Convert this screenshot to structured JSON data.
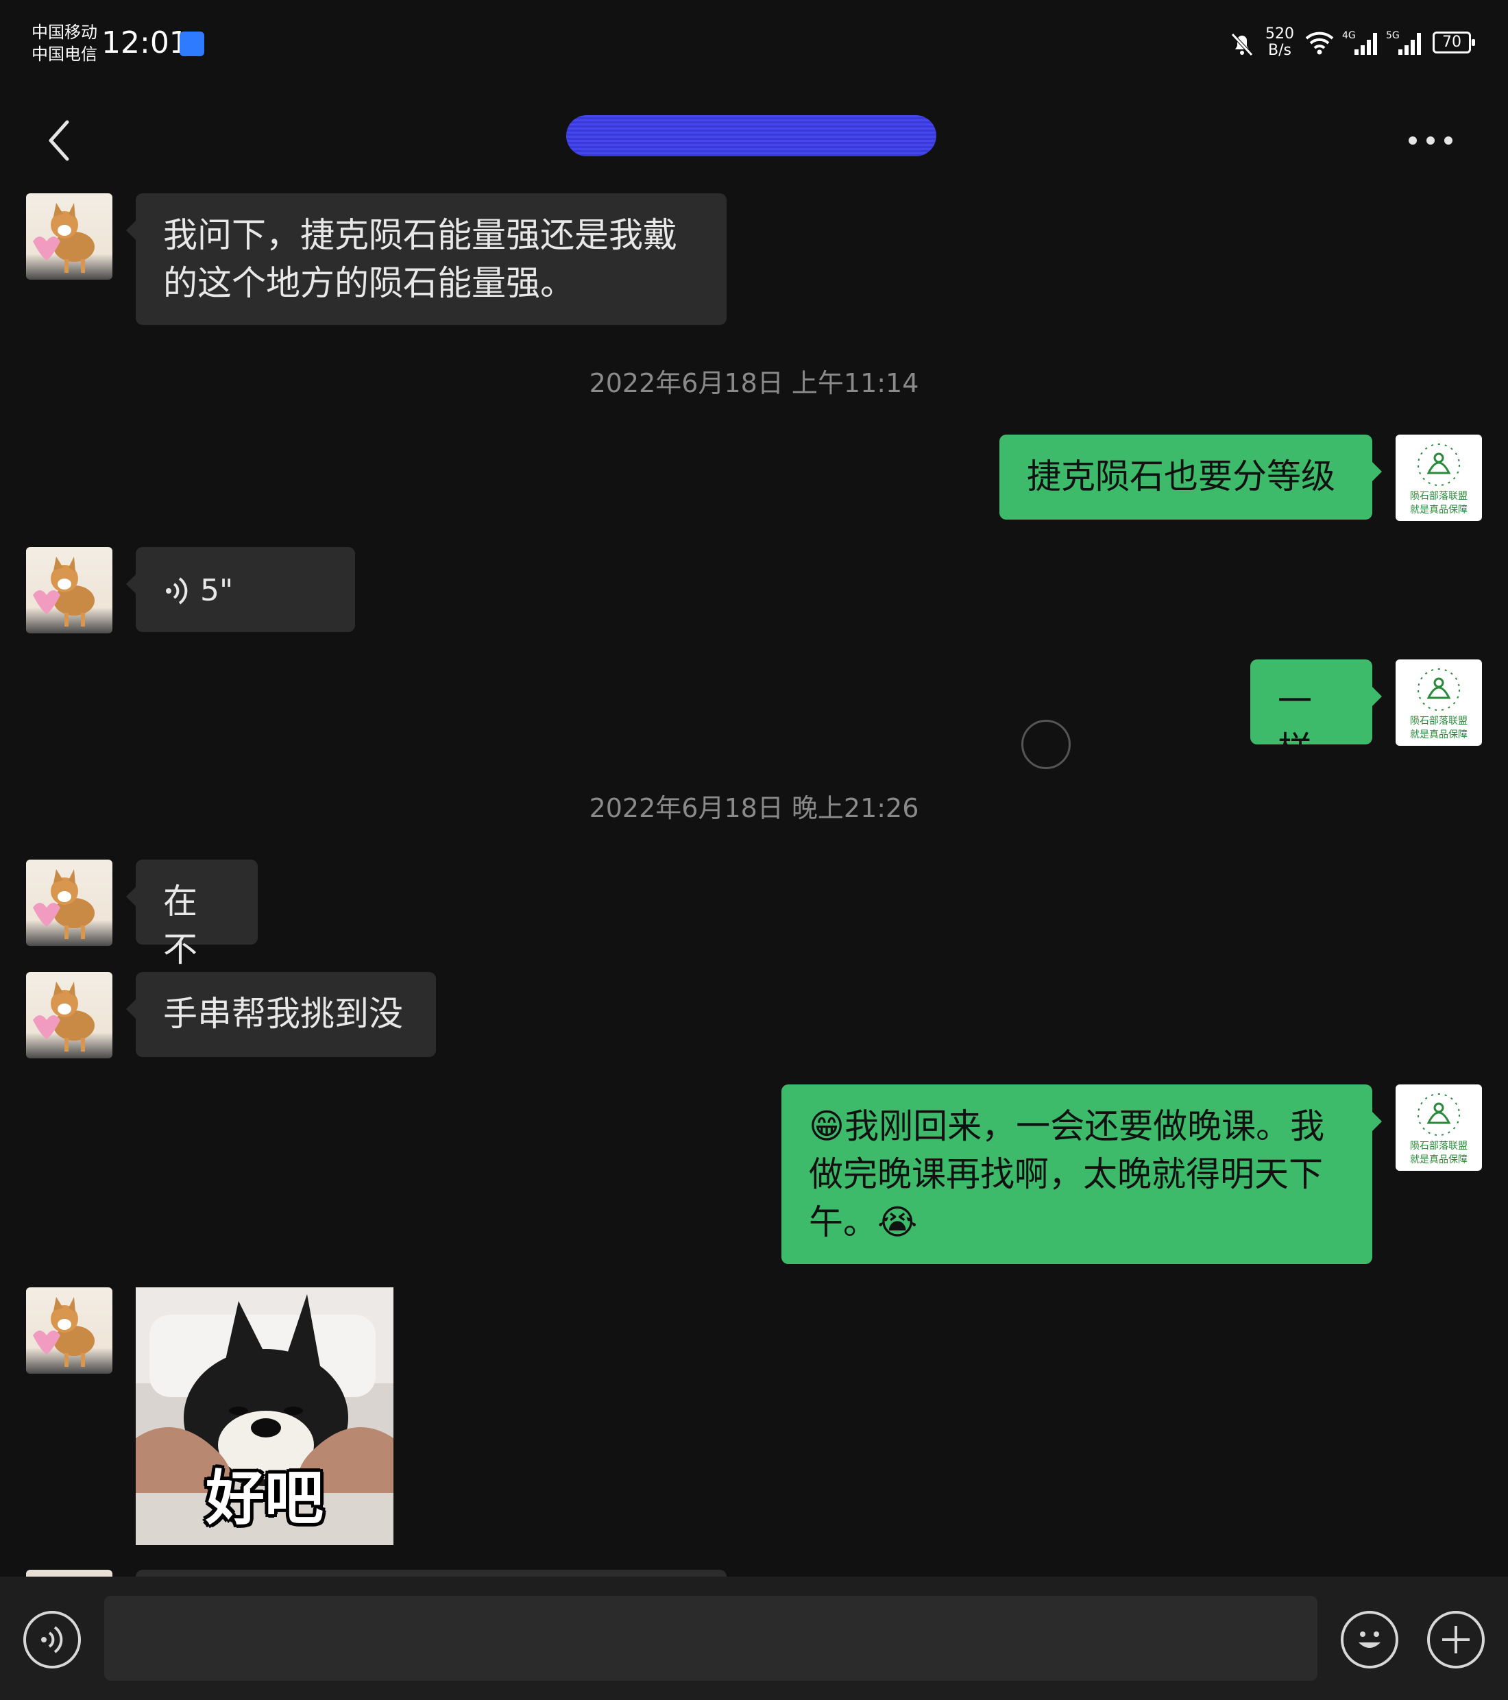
{
  "status_bar": {
    "carrier1": "中国移动",
    "carrier2": "中国电信",
    "time": "12:01",
    "net_speed_value": "520",
    "net_speed_unit": "B/s",
    "battery": "70",
    "icons": [
      "bell-off-icon",
      "wifi-icon",
      "signal-4g-icon",
      "signal-5g-icon",
      "battery-icon"
    ]
  },
  "nav": {
    "back_icon": "chevron-left-icon",
    "more_icon": "more-dots-icon"
  },
  "messages": [
    {
      "side": "in",
      "type": "text",
      "text": "我问下，捷克陨石能量强还是我戴的这个地方的陨石能量强。"
    },
    {
      "type": "time",
      "text": "2022年6月18日 上午11:14"
    },
    {
      "side": "out",
      "type": "text",
      "text": "捷克陨石也要分等级"
    },
    {
      "side": "in",
      "type": "voice",
      "text": "5\""
    },
    {
      "side": "out",
      "type": "text",
      "text": "一样"
    },
    {
      "type": "time",
      "text": "2022年6月18日 晚上21:26"
    },
    {
      "side": "in",
      "type": "text",
      "text": "在不"
    },
    {
      "side": "in",
      "type": "text",
      "text": "手串帮我挑到没"
    },
    {
      "side": "out",
      "type": "text",
      "text": "😁我刚回来，一会还要做晚课。我做完晚课再找啊，太晚就得明天下午。😭"
    },
    {
      "side": "in",
      "type": "sticker",
      "text": "好吧"
    }
  ],
  "logo_avatar_text": [
    "陨石部落联盟",
    "就是真品保障"
  ],
  "bottom": {
    "voice_icon": "voice-input-icon",
    "emoji_icon": "emoji-icon",
    "plus_icon": "plus-icon",
    "input_value": ""
  },
  "colors": {
    "background": "#111111",
    "incoming_bubble": "#2c2c2c",
    "outgoing_bubble": "#3dbb6a",
    "redaction": "#4040e0"
  }
}
